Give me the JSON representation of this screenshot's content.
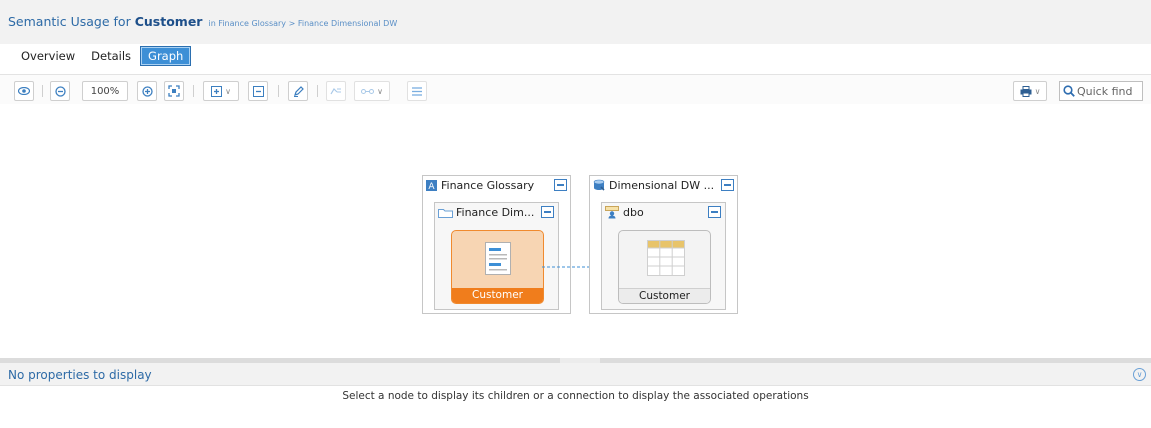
{
  "header": {
    "title_prefix": "Semantic Usage for",
    "title_object": "Customer",
    "title_path": "in Finance Glossary > Finance Dimensional DW"
  },
  "tabs": [
    {
      "label": "Overview",
      "active": false
    },
    {
      "label": "Details",
      "active": false
    },
    {
      "label": "Graph",
      "active": true
    }
  ],
  "toolbar": {
    "zoom_value": "100%",
    "quick_find_placeholder": "Quick find"
  },
  "graph": {
    "left_group": {
      "title": "Finance Glossary",
      "folder": "Finance Dim...",
      "node_label": "Customer"
    },
    "right_group": {
      "title": "Dimensional DW ...",
      "schema": "dbo",
      "node_label": "Customer"
    }
  },
  "properties": {
    "empty_text": "No properties to display",
    "hint": "Select a node to display its children or a connection to display the associated operations"
  },
  "colors": {
    "accent": "#3d8fd6",
    "selected_node": "#f7d5b3",
    "selected_node_label": "#f07d1c"
  }
}
